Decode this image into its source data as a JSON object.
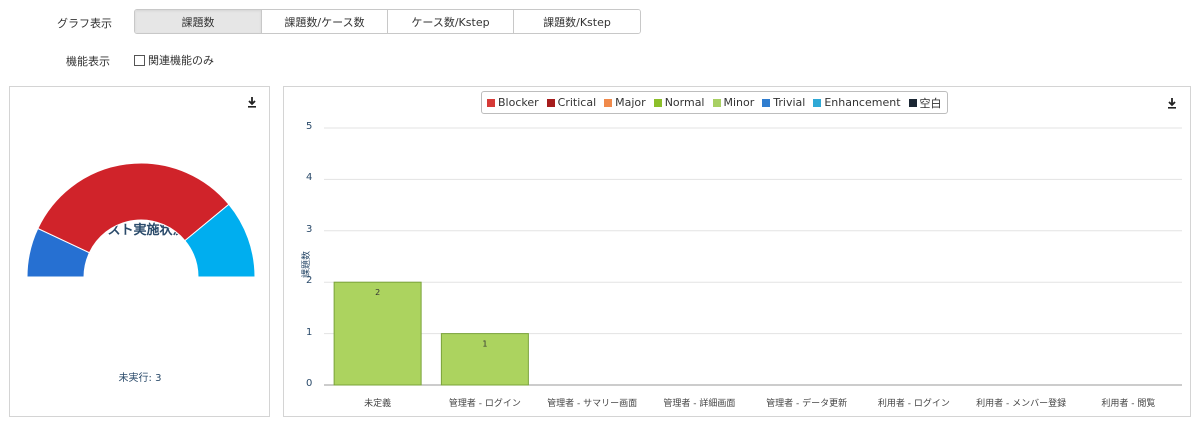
{
  "controls": {
    "graph_label": "グラフ表示",
    "feature_label": "機能表示",
    "tabs": [
      {
        "label": "課題数",
        "active": true
      },
      {
        "label": "課題数/ケース数",
        "active": false
      },
      {
        "label": "ケース数/Kstep",
        "active": false
      },
      {
        "label": "課題数/Kstep",
        "active": false
      }
    ],
    "related_only_label": "関連機能のみ",
    "related_only_checked": false
  },
  "gauge": {
    "title": "テスト実施状況",
    "caption": "未実行: 3",
    "segments": [
      {
        "color": "#2670d2",
        "fraction": 0.14
      },
      {
        "color": "#d0232a",
        "fraction": 0.64
      },
      {
        "color": "#00aeef",
        "fraction": 0.22
      }
    ],
    "download_icon": "download-icon"
  },
  "legend": [
    {
      "name": "Blocker",
      "color": "#d63a37"
    },
    {
      "name": "Critical",
      "color": "#a61c1c"
    },
    {
      "name": "Major",
      "color": "#f08a4b"
    },
    {
      "name": "Normal",
      "color": "#8cbf2a"
    },
    {
      "name": "Minor",
      "color": "#a8d063"
    },
    {
      "name": "Trivial",
      "color": "#2f7dcf"
    },
    {
      "name": "Enhancement",
      "color": "#2fa9d6"
    },
    {
      "name": "空白",
      "color": "#1a2633"
    }
  ],
  "chart_data": {
    "type": "bar",
    "ylabel": "課題数",
    "ylim": [
      0,
      5
    ],
    "yticks": [
      "0",
      "1",
      "2",
      "3",
      "4",
      "5"
    ],
    "categories": [
      "未定義",
      "管理者 - ログイン",
      "管理者 - サマリー画面",
      "管理者 - 詳細画面",
      "管理者 - データ更新",
      "利用者 - ログイン",
      "利用者 - メンバー登録",
      "利用者 - 閲覧"
    ],
    "series": [
      {
        "name": "Minor",
        "color": "#acd35f",
        "values": [
          2,
          1,
          0,
          0,
          0,
          0,
          0,
          0
        ]
      }
    ],
    "data_labels": [
      "2",
      "1"
    ]
  }
}
